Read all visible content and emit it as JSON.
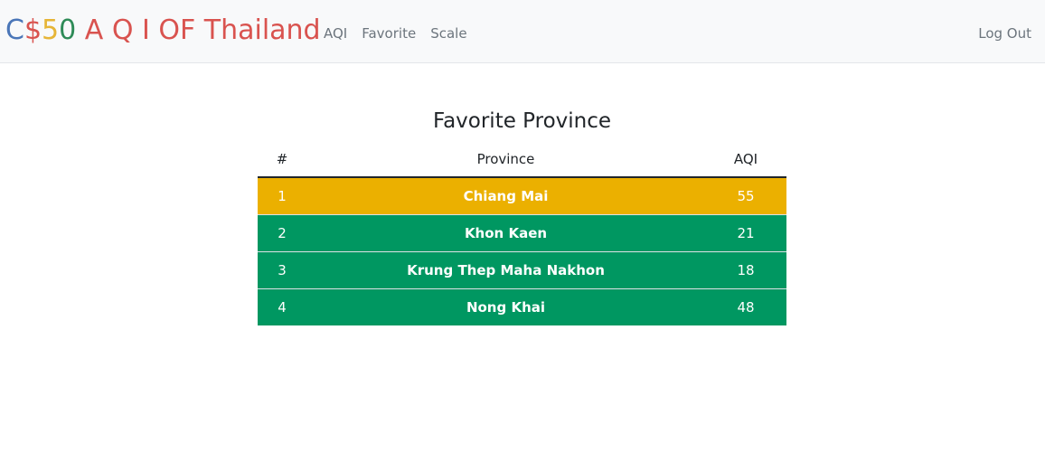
{
  "navbar": {
    "brand_parts": [
      {
        "text": "C",
        "color": "#4a76b8"
      },
      {
        "text": "$",
        "color": "#d9534f"
      },
      {
        "text": "5",
        "color": "#e6b537"
      },
      {
        "text": "0",
        "color": "#2e8b57"
      },
      {
        "text": " A Q I OF Thailand",
        "color": "#d9534f"
      }
    ],
    "links": [
      "AQI",
      "Favorite",
      "Scale"
    ],
    "logout_label": "Log Out"
  },
  "page": {
    "title": "Favorite Province"
  },
  "table": {
    "headers": [
      "#",
      "Province",
      "AQI"
    ],
    "rows": [
      {
        "index": "1",
        "province": "Chiang Mai",
        "aqi": "55",
        "color": "#ebb000"
      },
      {
        "index": "2",
        "province": "Khon Kaen",
        "aqi": "21",
        "color": "#009761"
      },
      {
        "index": "3",
        "province": "Krung Thep Maha Nakhon",
        "aqi": "18",
        "color": "#009761"
      },
      {
        "index": "4",
        "province": "Nong Khai",
        "aqi": "48",
        "color": "#009761"
      }
    ]
  }
}
